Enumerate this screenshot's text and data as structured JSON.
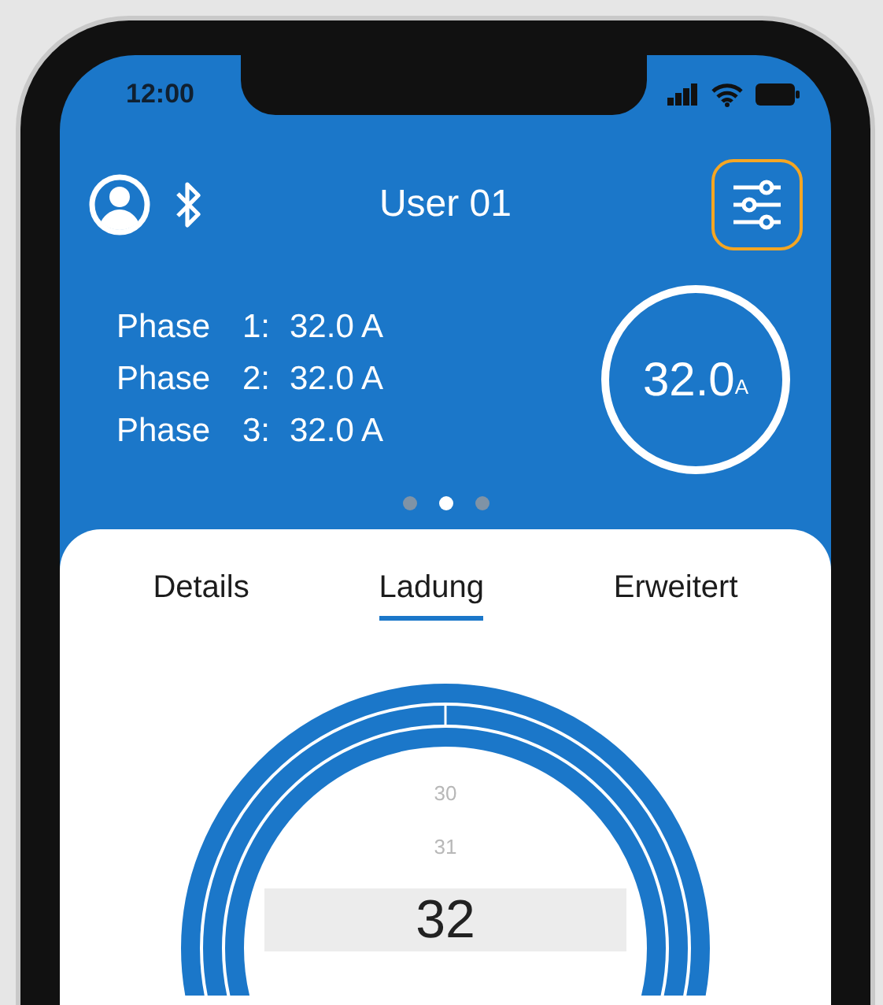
{
  "status_bar": {
    "time": "12:00"
  },
  "header": {
    "title": "User 01",
    "settings_highlighted": true
  },
  "phases": [
    {
      "label": "Phase",
      "number": "1:",
      "value": "32.0 A"
    },
    {
      "label": "Phase",
      "number": "2:",
      "value": "32.0 A"
    },
    {
      "label": "Phase",
      "number": "3:",
      "value": "32.0 A"
    }
  ],
  "total": {
    "value": "32.0",
    "unit": "A"
  },
  "page_dots": [
    {
      "selected": false
    },
    {
      "selected": true
    },
    {
      "selected": false
    }
  ],
  "tabs": [
    {
      "label": "Details",
      "selected": false
    },
    {
      "label": "Ladung",
      "selected": true
    },
    {
      "label": "Erweitert",
      "selected": false
    }
  ],
  "picker": [
    {
      "value": "30",
      "selected": false
    },
    {
      "value": "31",
      "selected": false
    },
    {
      "value": "32",
      "selected": true
    }
  ]
}
